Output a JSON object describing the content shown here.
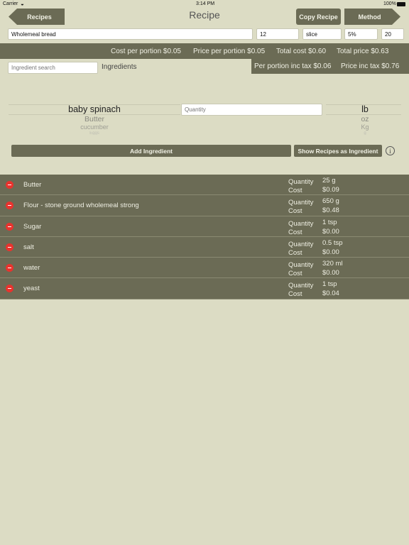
{
  "status_bar": {
    "carrier": "Carrier",
    "time": "3:14 PM",
    "battery": "100%"
  },
  "nav": {
    "back_label": "Recipes",
    "title": "Recipe",
    "copy_label": "Copy Recipe",
    "method_label": "Method"
  },
  "recipe": {
    "name": "Wholemeal bread",
    "portions": "12",
    "unit": "slice",
    "tax": "5%",
    "price": "20"
  },
  "totals": {
    "cost_per_portion": "Cost per portion  $0.05",
    "price_per_portion": "Price per portion  $0.05",
    "total_cost": "Total cost  $0.60",
    "total_price": "Total price  $0.63",
    "per_portion_inc_tax": "Per portion inc tax  $0.06",
    "price_inc_tax": "Price inc tax  $0.76"
  },
  "search": {
    "placeholder": "Ingredient search",
    "label": "Ingredients"
  },
  "ingredient_picker": [
    "baby spinach",
    "Butter",
    "cucumber",
    "Eggs"
  ],
  "quantity_placeholder": "Quantity",
  "unit_picker": [
    "lb",
    "oz",
    "Kg",
    "g"
  ],
  "actions": {
    "add_label": "Add Ingredient",
    "show_label": "Show Recipes as Ingredient",
    "info_symbol": "i"
  },
  "ingredients": [
    {
      "name": "Butter",
      "quantity_label": "Quantity",
      "cost_label": "Cost",
      "quantity": "25 g",
      "cost": "$0.09"
    },
    {
      "name": "Flour - stone ground wholemeal strong",
      "quantity_label": "Quantity",
      "cost_label": "Cost",
      "quantity": "650 g",
      "cost": "$0.48"
    },
    {
      "name": "Sugar",
      "quantity_label": "Quantity",
      "cost_label": "Cost",
      "quantity": "1 tsp",
      "cost": "$0.00"
    },
    {
      "name": "salt",
      "quantity_label": "Quantity",
      "cost_label": "Cost",
      "quantity": "0.5 tsp",
      "cost": "$0.00"
    },
    {
      "name": "water",
      "quantity_label": "Quantity",
      "cost_label": "Cost",
      "quantity": "320 ml",
      "cost": "$0.00"
    },
    {
      "name": "yeast",
      "quantity_label": "Quantity",
      "cost_label": "Cost",
      "quantity": "1 tsp",
      "cost": "$0.04"
    }
  ]
}
